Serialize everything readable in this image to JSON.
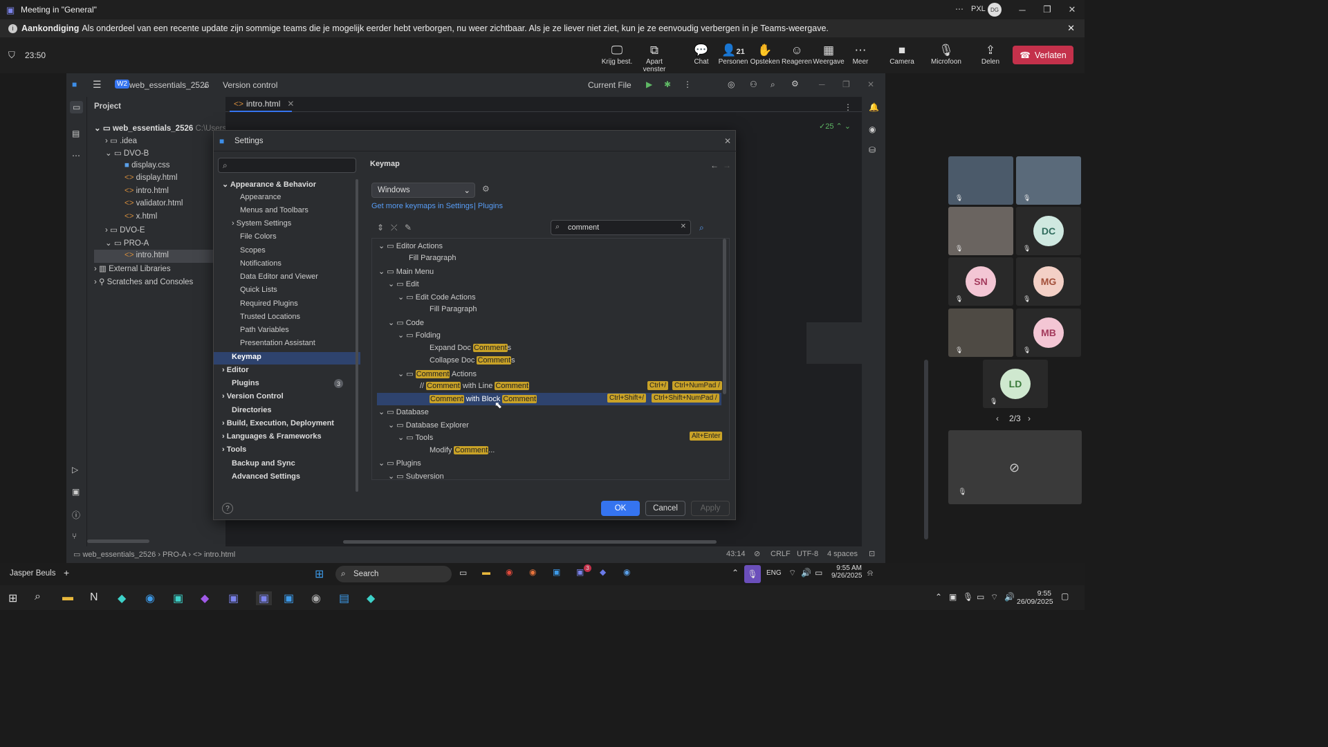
{
  "window": {
    "title": "Meeting in \"General\"",
    "user_initials": "DG",
    "org": "PXL"
  },
  "banner": {
    "label": "Aankondiging",
    "text": "Als onderdeel van een recente update zijn sommige teams die je mogelijk eerder hebt verborgen, nu weer zichtbaar. Als je ze liever niet ziet, kun je ze eenvoudig verbergen in je Teams-weergave."
  },
  "meeting": {
    "timer": "23:50",
    "participants": "21",
    "buttons": {
      "share_screen": "Krijg best.",
      "popout": "Apart venster",
      "chat": "Chat",
      "people": "Personen",
      "raise": "Opsteken",
      "react": "Reageren",
      "view": "Weergave",
      "more": "Meer",
      "camera": "Camera",
      "mic": "Microfoon",
      "share": "Delen",
      "leave": "Verlaten"
    },
    "page_indicator": "2/3"
  },
  "participants": [
    {
      "initials": "DC",
      "color": "#cfe8e0",
      "fg": "#2f6b5c"
    },
    {
      "initials": "SN",
      "color": "#f3c6d4",
      "fg": "#a33a5c"
    },
    {
      "initials": "MG",
      "color": "#f3d0c6",
      "fg": "#a3503a"
    },
    {
      "initials": "MB",
      "color": "#f3c6d4",
      "fg": "#a33a5c"
    },
    {
      "initials": "LD",
      "color": "#cfe8cf",
      "fg": "#3a7a3a"
    }
  ],
  "ide": {
    "project_badge": "W2",
    "project_name": "web_essentials_2526",
    "vcs": "Version control",
    "run_config": "Current File",
    "panel_title": "Project",
    "tab": "intro.html",
    "inspections": "25",
    "tree": [
      {
        "label": "web_essentials_2526",
        "suffix": "C:\\Users"
      },
      {
        "label": ".idea"
      },
      {
        "label": "DVO-B"
      },
      {
        "label": "display.css"
      },
      {
        "label": "display.html"
      },
      {
        "label": "intro.html"
      },
      {
        "label": "validator.html"
      },
      {
        "label": "x.html"
      },
      {
        "label": "DVO-E"
      },
      {
        "label": "PRO-A"
      },
      {
        "label": "intro.html"
      },
      {
        "label": "External Libraries"
      },
      {
        "label": "Scratches and Consoles"
      }
    ],
    "status": {
      "b1": "web_essentials_2526",
      "b2": "PRO-A",
      "b3": "intro.html",
      "pos": "43:14",
      "eol": "CRLF",
      "enc": "UTF-8",
      "indent": "4 spaces"
    }
  },
  "settings": {
    "title": "Settings",
    "search_placeholder": "",
    "nav": [
      "Appearance & Behavior",
      "Appearance",
      "Menus and Toolbars",
      "System Settings",
      "File Colors",
      "Scopes",
      "Notifications",
      "Data Editor and Viewer",
      "Quick Lists",
      "Required Plugins",
      "Trusted Locations",
      "Path Variables",
      "Presentation Assistant",
      "Keymap",
      "Editor",
      "Plugins",
      "Version Control",
      "Directories",
      "Build, Execution, Deployment",
      "Languages & Frameworks",
      "Tools",
      "Backup and Sync",
      "Advanced Settings"
    ],
    "plugins_badge": "3",
    "keymap": {
      "heading": "Keymap",
      "scheme": "Windows",
      "more_link": "Get more keymaps in Settings",
      "plugins_link": "Plugins",
      "search": "comment",
      "rows": {
        "r0": "Editor Actions",
        "r1": "Fill Paragraph",
        "r2": "Main Menu",
        "r3": "Edit",
        "r4": "Edit Code Actions",
        "r5": "Fill Paragraph",
        "r6": "Code",
        "r7": "Folding",
        "r8a": "Expand Doc ",
        "r8b": "Comment",
        "r8c": "s",
        "r9a": "Collapse Doc ",
        "r9b": "Comment",
        "r9c": "s",
        "r10a": "Comment",
        "r10b": " Actions",
        "r11a": "Comment",
        "r11b": " with Line ",
        "r11c": "Comment",
        "r12a": "Comment",
        "r12b": " with Block ",
        "r12c": "Comment",
        "r13": "Database",
        "r14": "Database Explorer",
        "r15": "Tools",
        "r16a": "Modify ",
        "r16b": "Comment",
        "r16c": "...",
        "r17": "Plugins",
        "r18": "Subversion"
      },
      "shortcuts": {
        "line1": "Ctrl+/",
        "line2": "Ctrl+NumPad /",
        "block1": "Ctrl+Shift+/",
        "block2": "Ctrl+Shift+NumPad /",
        "tools": "Alt+Enter"
      }
    },
    "buttons": {
      "ok": "OK",
      "cancel": "Cancel",
      "apply": "Apply"
    }
  },
  "taskbar": {
    "user": "Jasper Beuls",
    "search": "Search",
    "lang": "ENG",
    "time": "9:55 AM",
    "date": "9/26/2025",
    "time2": "9:55",
    "date2": "26/09/2025",
    "badge": "3"
  }
}
